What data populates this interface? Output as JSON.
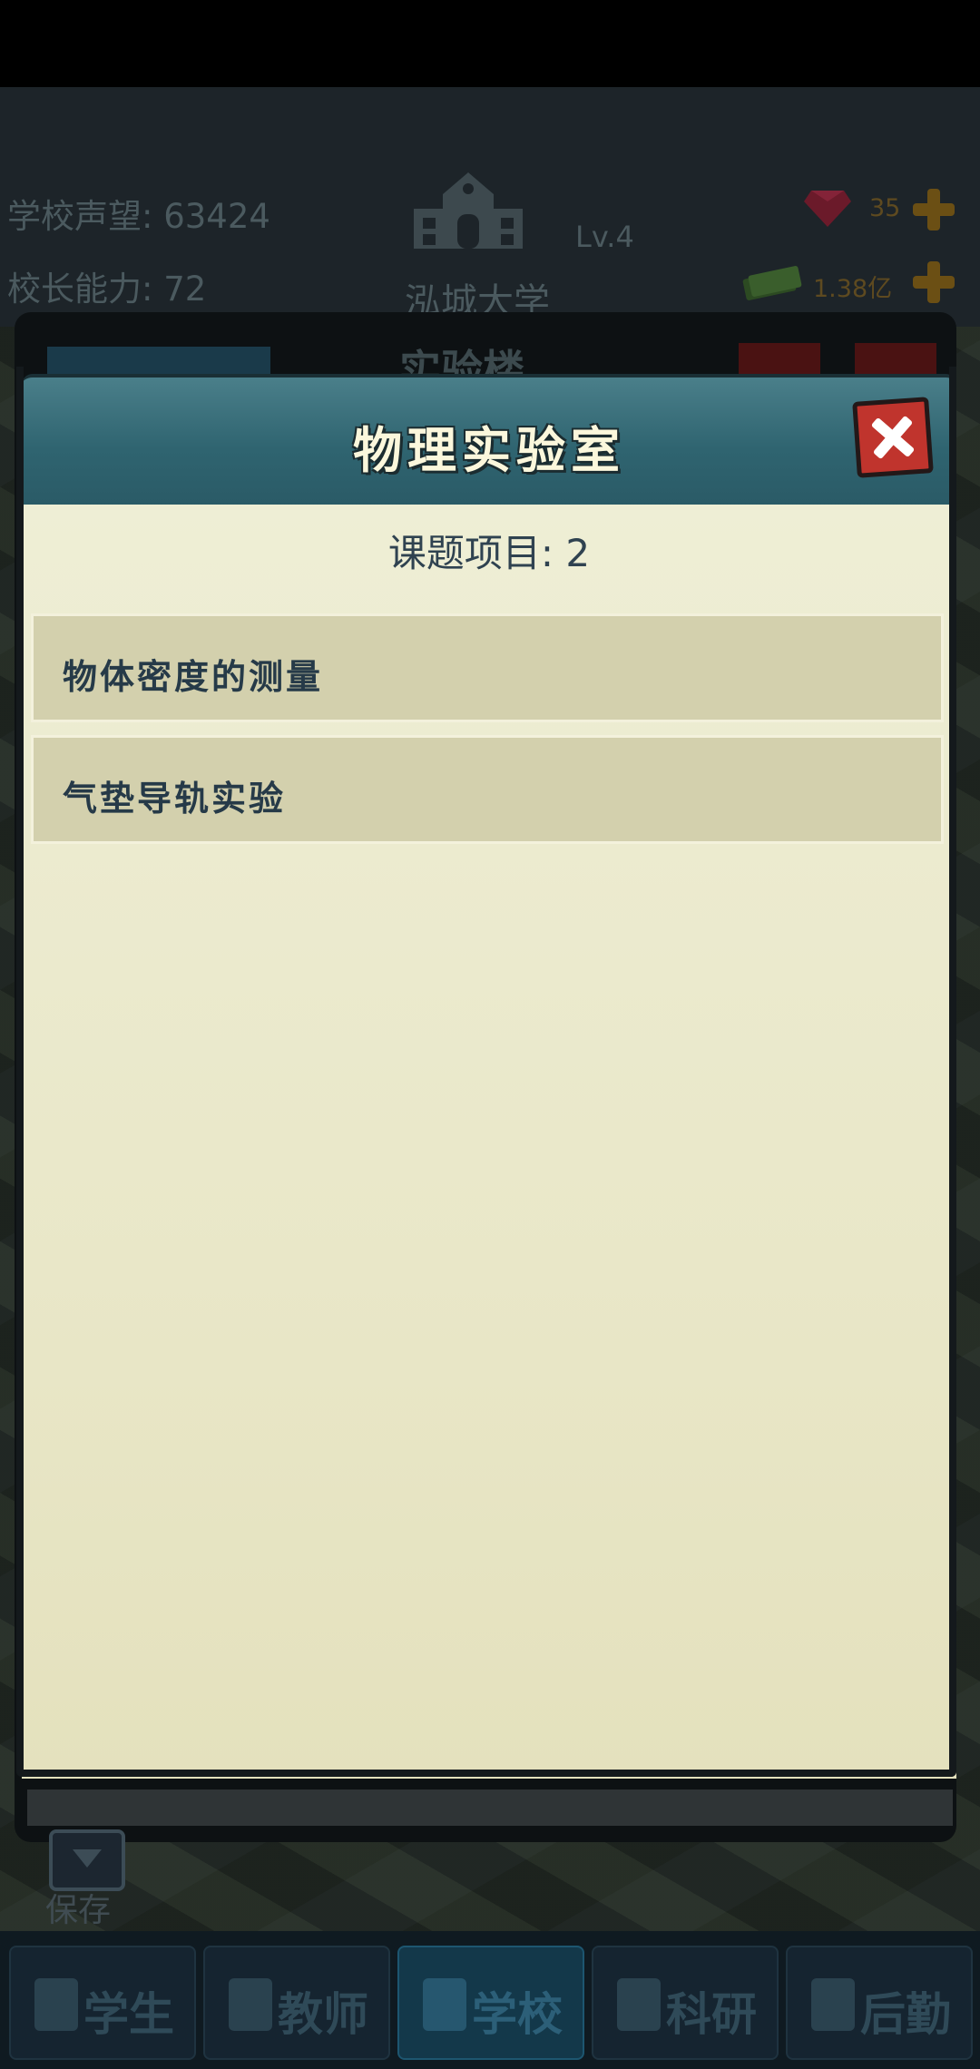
{
  "hud": {
    "reputation": "学校声望: 63424",
    "principal_ability": "校长能力: 72",
    "school_level": "Lv.4",
    "school_name": "泓城大学",
    "gems": "35",
    "money": "1.38亿"
  },
  "background": {
    "panel_title": "实验楼",
    "save_label": "保存"
  },
  "dialog": {
    "title": "物理实验室",
    "project_count": "课题项目: 2",
    "projects": [
      {
        "label": "物体密度的测量"
      },
      {
        "label": "气垫导轨实验"
      }
    ]
  },
  "nav": {
    "tabs": [
      {
        "label": "学生",
        "icon": "student-icon"
      },
      {
        "label": "教师",
        "icon": "teacher-icon"
      },
      {
        "label": "学校",
        "icon": "school-icon",
        "active": true
      },
      {
        "label": "科研",
        "icon": "flask-icon"
      },
      {
        "label": "后勤",
        "icon": "clipboard-icon"
      }
    ]
  },
  "colors": {
    "header_teal": "#2f6470",
    "body_cream": "#e9e7c8",
    "item_bg": "#d3d0ad",
    "close_red": "#c0342d"
  }
}
